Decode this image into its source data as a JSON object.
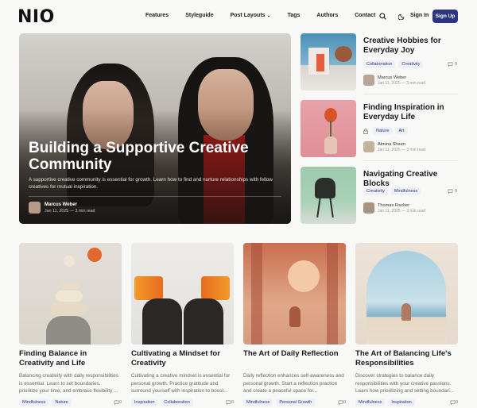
{
  "header": {
    "logo": "NIO",
    "nav": [
      {
        "label": "Features"
      },
      {
        "label": "Styleguide"
      },
      {
        "label": "Post Layouts"
      },
      {
        "label": "Tags"
      },
      {
        "label": "Authors"
      },
      {
        "label": "Contact"
      }
    ],
    "icons": [
      "search-icon",
      "moon-icon"
    ],
    "sign_in": "Sign In",
    "sign_up": "Sign Up",
    "accent_color": "#2d3580"
  },
  "hero": {
    "title": "Building a Supportive Creative Community",
    "excerpt": "A supportive creative community is essential for growth. Learn how to find and nurture relationships with fellow creatives for mutual inspiration.",
    "author": "Marcus Weber",
    "meta": "Jan 11, 2025 — 3 min read"
  },
  "side_posts": [
    {
      "title": "Creative Hobbies for Everyday Joy",
      "tags": [
        "Collaboration",
        "Creativity"
      ],
      "comments": "0",
      "author": "Marcus Weber",
      "meta": "Jan 11, 2025 — 3 min read"
    },
    {
      "title": "Finding Inspiration in Everyday Life",
      "tags": [
        "Nature",
        "Art"
      ],
      "comments": "",
      "author": "Almina Sheen",
      "meta": "Jan 11, 2025 — 3 min read"
    },
    {
      "title": "Navigating Creative Blocks",
      "tags": [
        "Creativity",
        "Mindfulness"
      ],
      "comments": "0",
      "author": "Thomas Fischer",
      "meta": "Jan 11, 2025 — 3 min read"
    }
  ],
  "cards": [
    {
      "title": "Finding Balance in Creativity and Life",
      "excerpt": "Balancing creativity with daily responsibilities is essential. Learn to set boundaries, prioritize your time, and embrace flexibility ...",
      "tags": [
        "Mindfulness",
        "Nature"
      ],
      "comments": "0"
    },
    {
      "title": "Cultivating a Mindset for Creativity",
      "excerpt": "Cultivating a creative mindset is essential for personal growth. Practice gratitude and surround yourself with inspiration to boost...",
      "tags": [
        "Inspiration",
        "Collaboration"
      ],
      "comments": "0"
    },
    {
      "title": "The Art of Daily Reflection",
      "excerpt": "Daily reflection enhances self-awareness and personal growth. Start a reflection practice and create a peaceful space for...",
      "tags": [
        "Mindfulness",
        "Personal Growth"
      ],
      "comments": "0"
    },
    {
      "title": "The Art of Balancing Life's Responsibilities",
      "excerpt": "Discover strategies to balance daily responsibilities with your creative passions. Learn how prioritizing and setting boundari...",
      "tags": [
        "Mindfulness",
        "Inspiration"
      ],
      "comments": "0"
    }
  ]
}
